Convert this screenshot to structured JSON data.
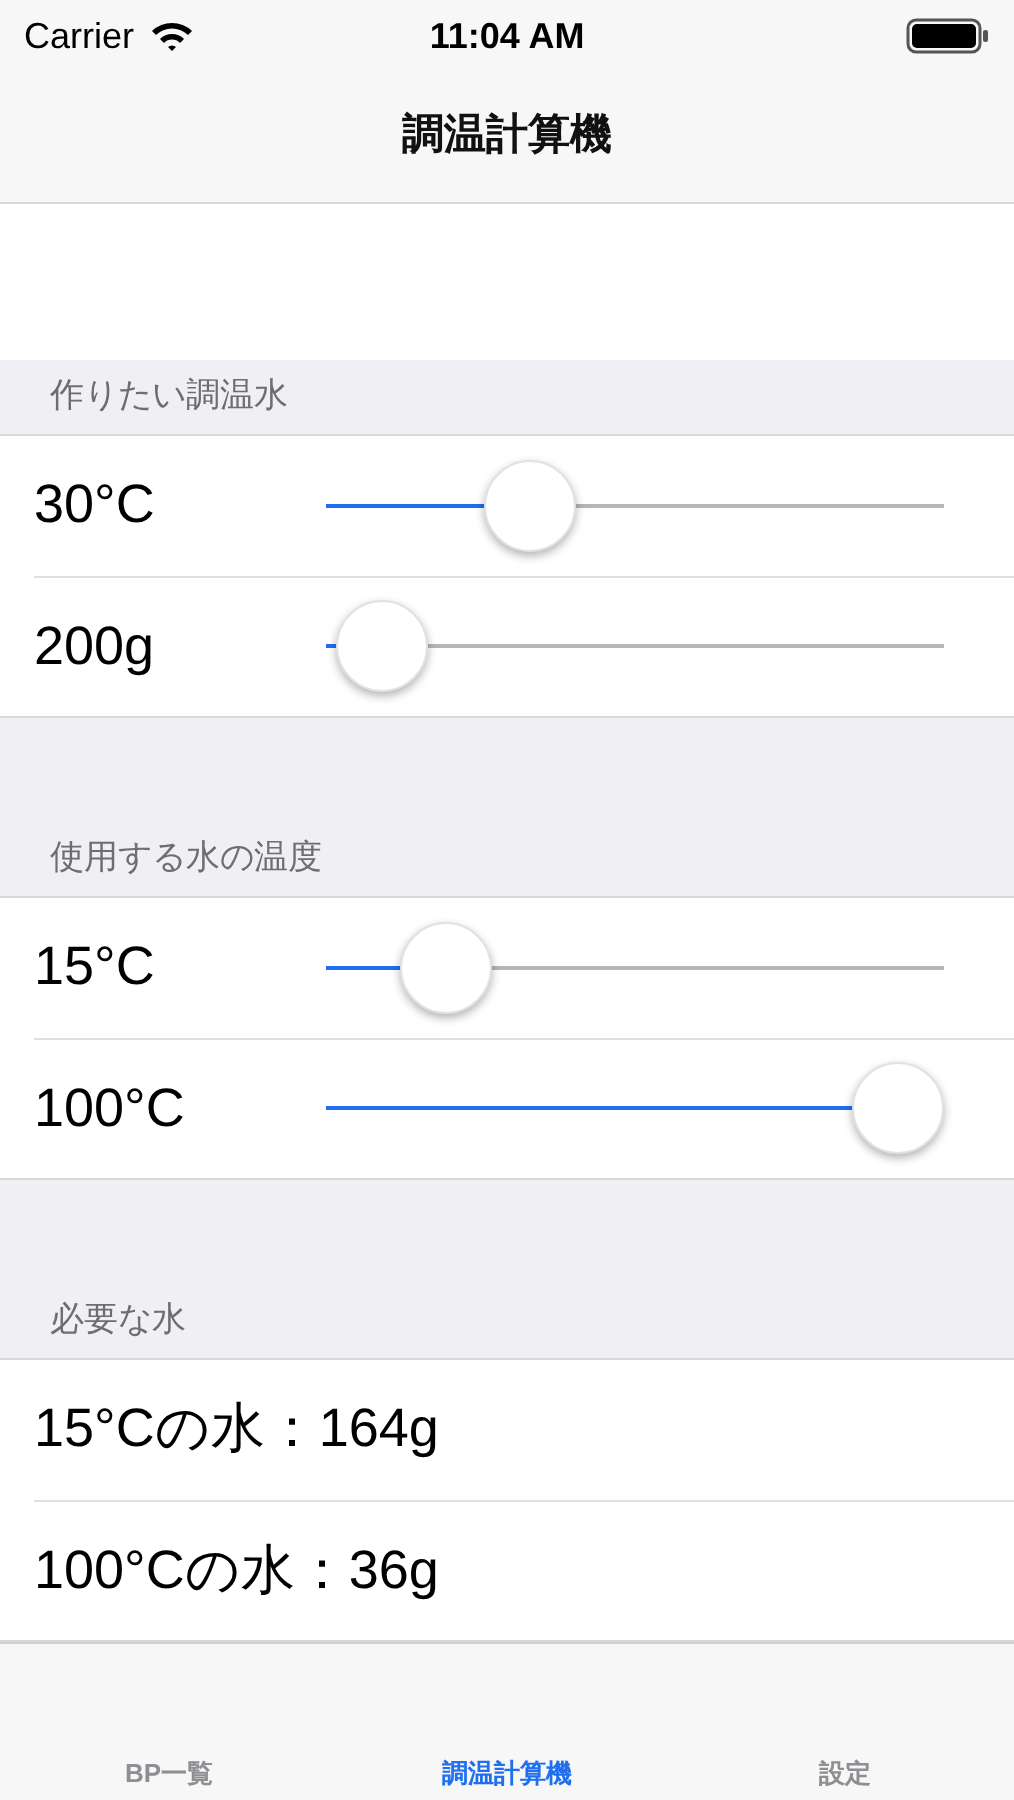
{
  "status_bar": {
    "carrier": "Carrier",
    "time": "11:04 AM"
  },
  "nav_bar": {
    "title": "調温計算機"
  },
  "sections": [
    {
      "header": "作りたい調温水",
      "kind": "sliders",
      "rows": [
        {
          "label": "30°C",
          "level": 0.3
        },
        {
          "label": "200g",
          "level": 0.02
        }
      ]
    },
    {
      "header": "使用する水の温度",
      "kind": "sliders",
      "rows": [
        {
          "label": "15°C",
          "level": 0.14
        },
        {
          "label": "100°C",
          "level": 1
        }
      ]
    },
    {
      "header": "必要な水",
      "kind": "results",
      "rows": [
        {
          "label": "15°Cの水：164g"
        },
        {
          "label": "100°Cの水：36g"
        }
      ]
    }
  ],
  "tab_bar": [
    {
      "label": "BP一覧",
      "selected": false
    },
    {
      "label": "調温計算機",
      "selected": true
    },
    {
      "label": "設定",
      "selected": false
    }
  ]
}
